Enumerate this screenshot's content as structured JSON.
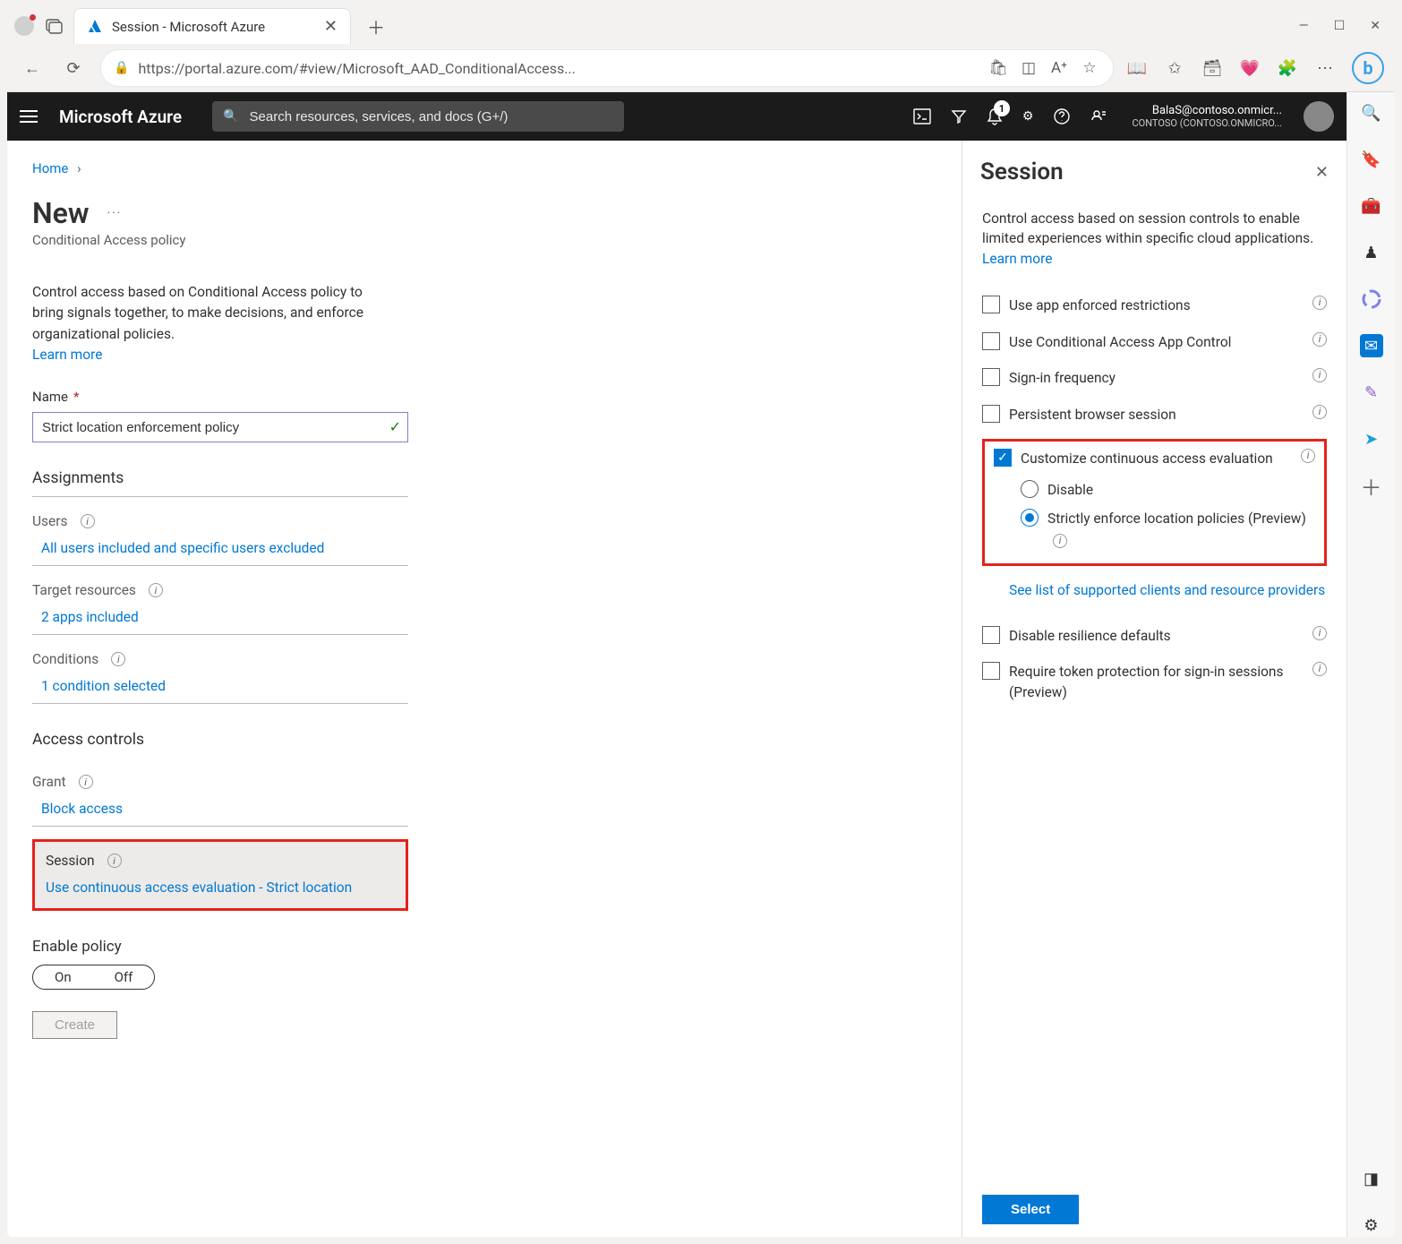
{
  "browser": {
    "tab_title": "Session - Microsoft Azure",
    "url": "https://portal.azure.com/#view/Microsoft_AAD_ConditionalAccess..."
  },
  "topbar": {
    "brand": "Microsoft Azure",
    "search_placeholder": "Search resources, services, and docs (G+/)",
    "notification_count": "1",
    "account_user": "BalaS@contoso.onmicr...",
    "account_tenant": "CONTOSO (CONTOSO.ONMICRO..."
  },
  "breadcrumb": {
    "home": "Home"
  },
  "page": {
    "title": "New",
    "subtitle": "Conditional Access policy",
    "intro": "Control access based on Conditional Access policy to bring signals together, to make decisions, and enforce organizational policies.",
    "learn_more": "Learn more",
    "name_label": "Name",
    "name_value": "Strict location enforcement policy"
  },
  "sections": {
    "assignments": "Assignments",
    "users_label": "Users",
    "users_value": "All users included and specific users excluded",
    "target_label": "Target resources",
    "target_value": "2 apps included",
    "conditions_label": "Conditions",
    "conditions_value": "1 condition selected",
    "access_controls": "Access controls",
    "grant_label": "Grant",
    "grant_value": "Block access",
    "session_label": "Session",
    "session_value": "Use continuous access evaluation - Strict location"
  },
  "enable": {
    "label": "Enable policy",
    "on": "On",
    "off": "Off",
    "create": "Create"
  },
  "side": {
    "title": "Session",
    "intro": "Control access based on session controls to enable limited experiences within specific cloud applications.",
    "learn_more": "Learn more",
    "opt_app_enforced": "Use app enforced restrictions",
    "opt_ca_app_control": "Use Conditional Access App Control",
    "opt_signin_freq": "Sign-in frequency",
    "opt_persistent": "Persistent browser session",
    "opt_cae": "Customize continuous access evaluation",
    "radio_disable": "Disable",
    "radio_strict": "Strictly enforce location policies (Preview)",
    "clients_link": "See list of supported clients and resource providers",
    "opt_disable_resilience": "Disable resilience defaults",
    "opt_token": "Require token protection for sign-in sessions (Preview)",
    "select_btn": "Select"
  }
}
